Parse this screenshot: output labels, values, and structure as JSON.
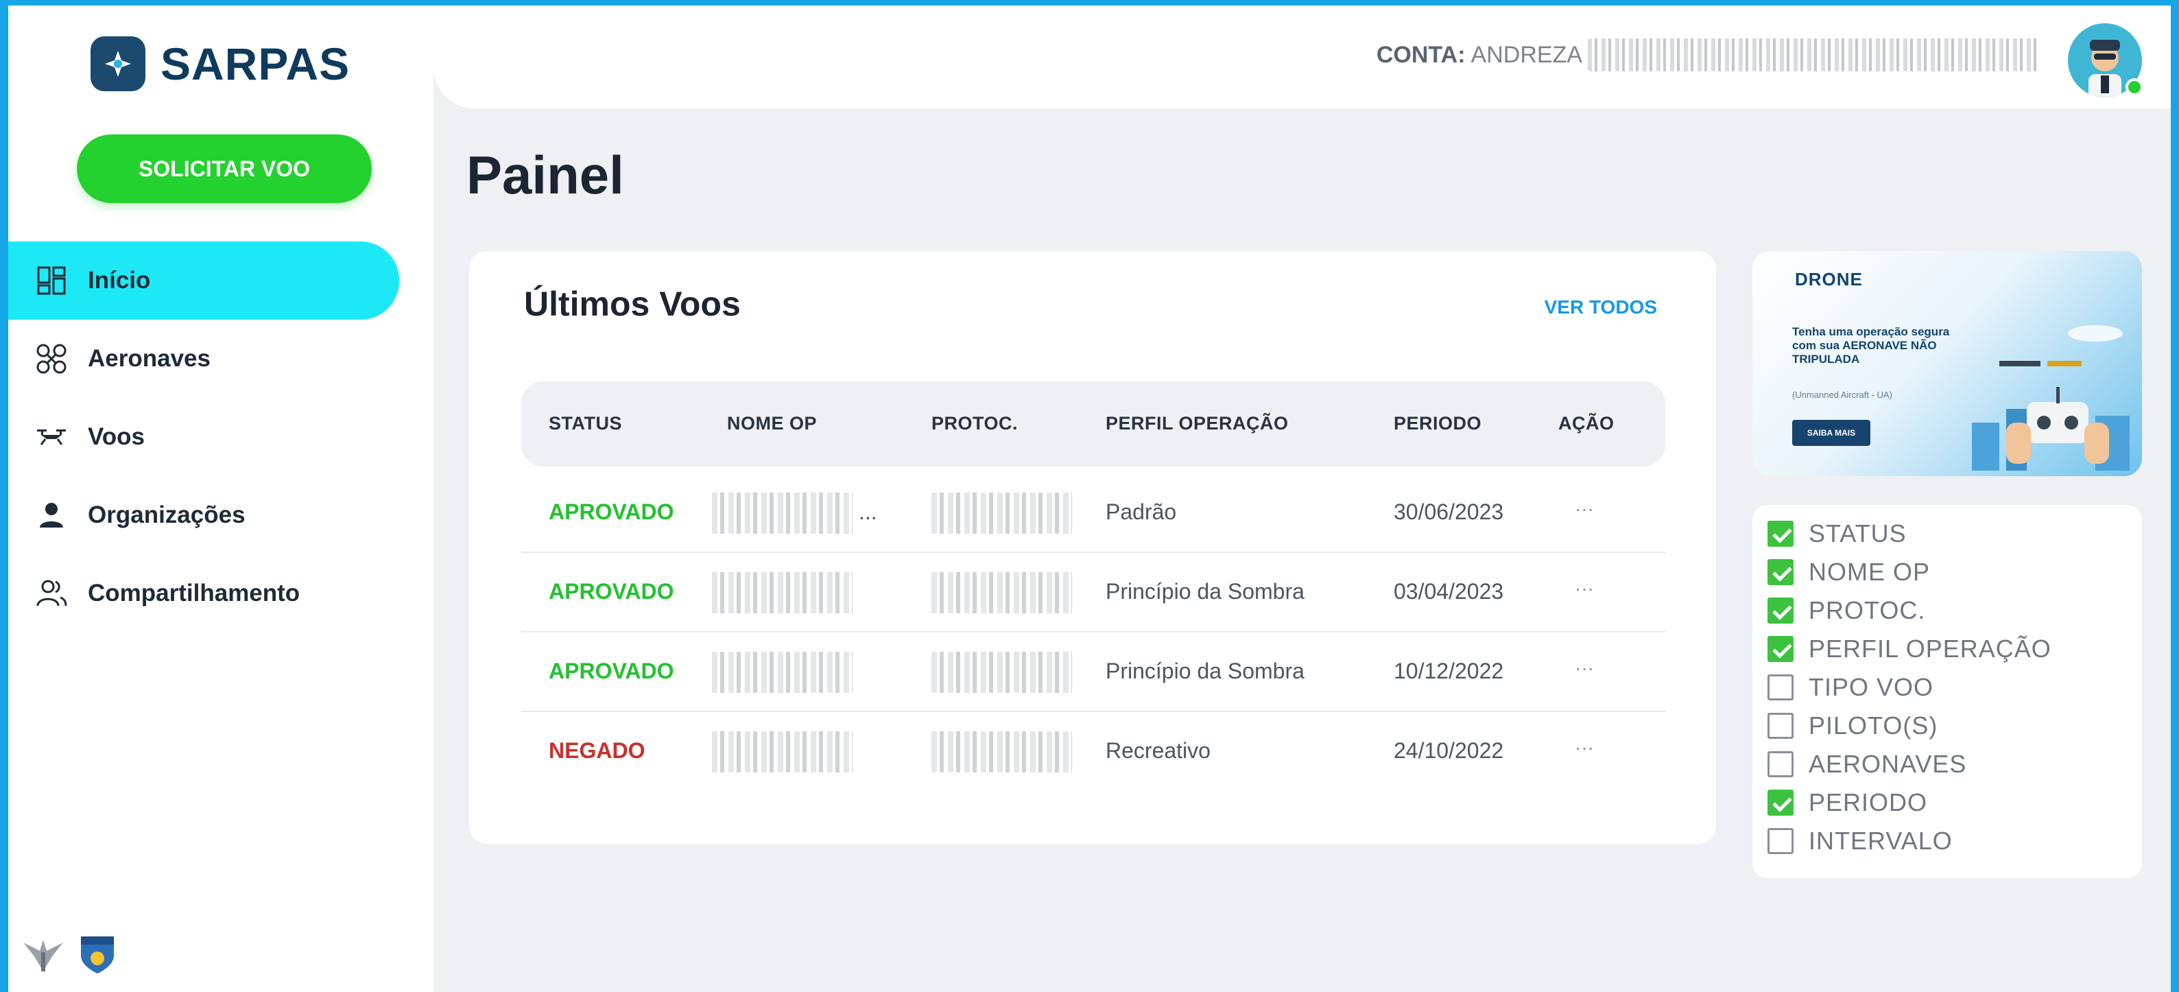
{
  "app": {
    "logo_text": "SARPAS"
  },
  "sidebar": {
    "cta": "SOLICITAR VOO",
    "items": [
      {
        "label": "Início",
        "icon": "dashboard-icon",
        "active": true
      },
      {
        "label": "Aeronaves",
        "icon": "drone-icon",
        "active": false
      },
      {
        "label": "Voos",
        "icon": "flight-icon",
        "active": false
      },
      {
        "label": "Organizações",
        "icon": "person-icon",
        "active": false
      },
      {
        "label": "Compartilhamento",
        "icon": "people-icon",
        "active": false
      }
    ]
  },
  "header": {
    "account_label": "CONTA:",
    "account_name": "ANDREZA"
  },
  "page": {
    "title": "Painel"
  },
  "flights_card": {
    "title": "Últimos Voos",
    "see_all": "VER TODOS",
    "columns": [
      "STATUS",
      "NOME OP",
      "PROTOC.",
      "PERFIL OPERAÇÃO",
      "PERIODO",
      "AÇÃO"
    ],
    "rows": [
      {
        "status": "APROVADO",
        "status_color": "#23c12e",
        "profile": "Padrão",
        "period": "30/06/2023",
        "action": "···",
        "name_suffix": "..."
      },
      {
        "status": "APROVADO",
        "status_color": "#23c12e",
        "profile": "Princípio da Sombra",
        "period": "03/04/2023",
        "action": "···",
        "name_suffix": ""
      },
      {
        "status": "APROVADO",
        "status_color": "#23c12e",
        "profile": "Princípio da Sombra",
        "period": "10/12/2022",
        "action": "···",
        "name_suffix": ""
      },
      {
        "status": "NEGADO",
        "status_color": "#c9302c",
        "profile": "Recreativo",
        "period": "24/10/2022",
        "action": "···",
        "name_suffix": ""
      }
    ]
  },
  "ad": {
    "brand": "DRONE",
    "headline": "Tenha uma operação segura com sua AERONAVE NÃO TRIPULADA",
    "note": "(Unmanned Aircraft - UA)",
    "button": "SAIBA MAIS"
  },
  "column_picker": {
    "options": [
      {
        "label": "STATUS",
        "checked": true
      },
      {
        "label": "NOME OP",
        "checked": true
      },
      {
        "label": "PROTOC.",
        "checked": true
      },
      {
        "label": "PERFIL OPERAÇÃO",
        "checked": true
      },
      {
        "label": "TIPO VOO",
        "checked": false
      },
      {
        "label": "PILOTO(S)",
        "checked": false
      },
      {
        "label": "AERONAVES",
        "checked": false
      },
      {
        "label": "PERIODO",
        "checked": true
      },
      {
        "label": "INTERVALO",
        "checked": false
      }
    ]
  },
  "colors": {
    "accent_green": "#23d12f",
    "active_nav": "#1de9f6",
    "link_blue": "#1599e6",
    "approved": "#23c12e",
    "denied": "#c9302c"
  }
}
